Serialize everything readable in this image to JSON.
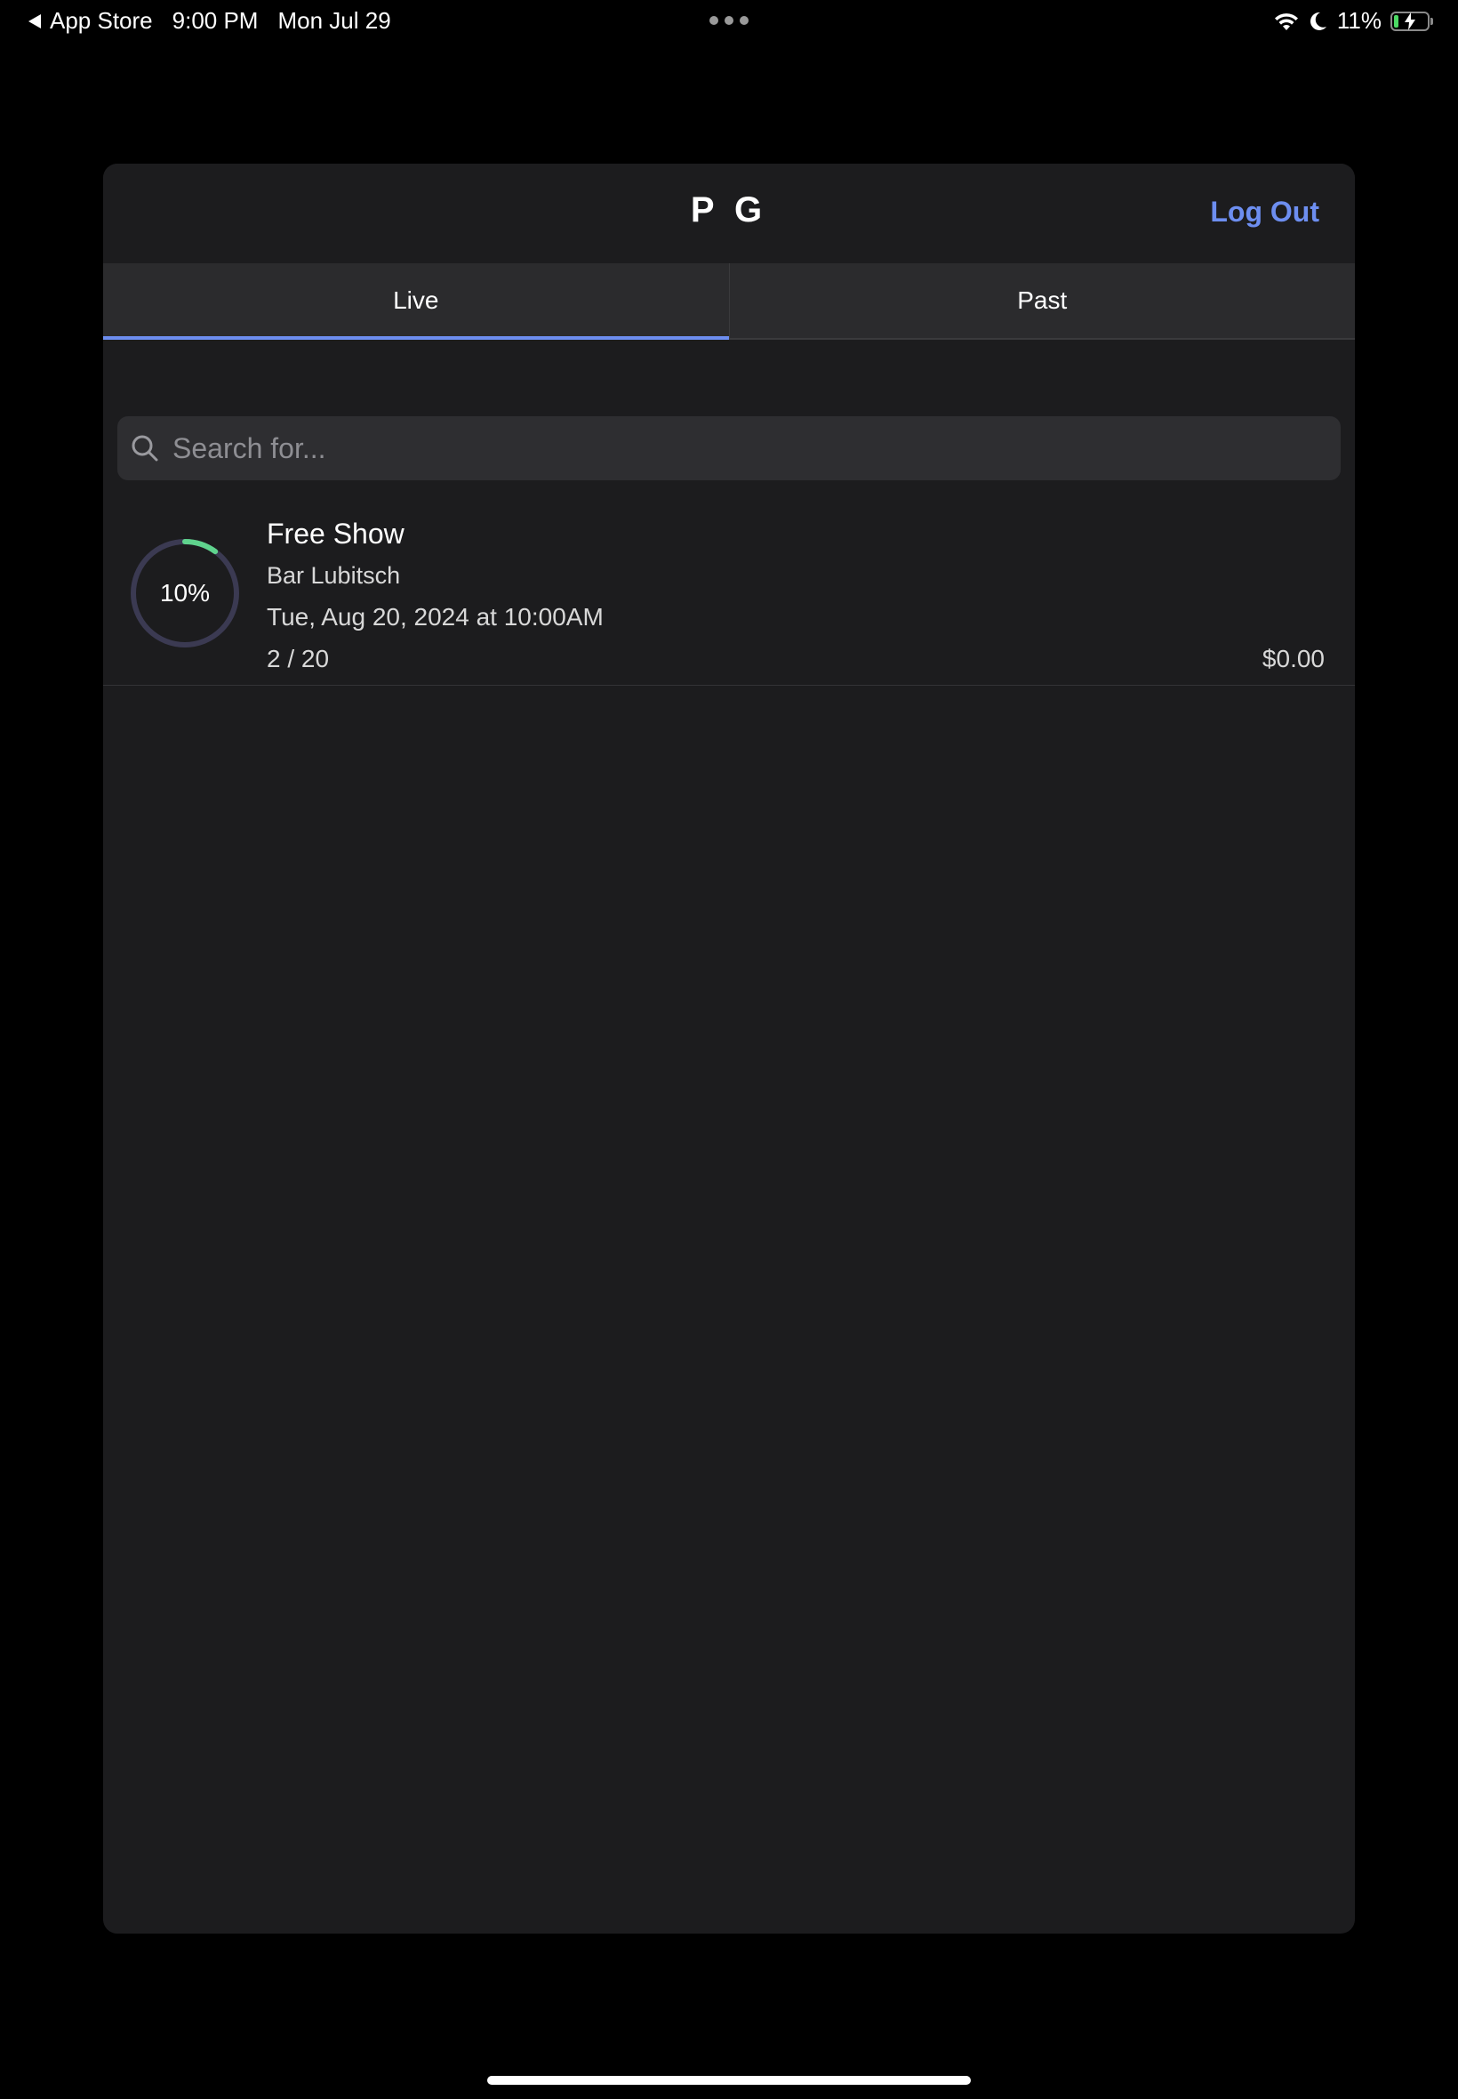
{
  "status_bar": {
    "back_label": "App Store",
    "time": "9:00 PM",
    "date": "Mon Jul 29",
    "battery": "11%",
    "icons": [
      "wifi-icon",
      "moon-icon",
      "battery-charging-icon"
    ]
  },
  "header": {
    "title": "P G",
    "logout_label": "Log Out"
  },
  "tabs": [
    {
      "label": "Live",
      "active": true
    },
    {
      "label": "Past",
      "active": false
    }
  ],
  "search": {
    "placeholder": "Search for...",
    "value": ""
  },
  "events": [
    {
      "title": "Free Show",
      "venue": "Bar Lubitsch",
      "datetime": "Tue, Aug 20, 2024 at 10:00AM",
      "sold": "2 / 20",
      "price": "$0.00",
      "progress_label": "10%",
      "progress_fraction": 0.1
    }
  ],
  "colors": {
    "accent": "#6d8ef0",
    "progress": "#5fd38d",
    "ring_track": "#3b3a52",
    "card_bg": "#1c1c1e"
  }
}
